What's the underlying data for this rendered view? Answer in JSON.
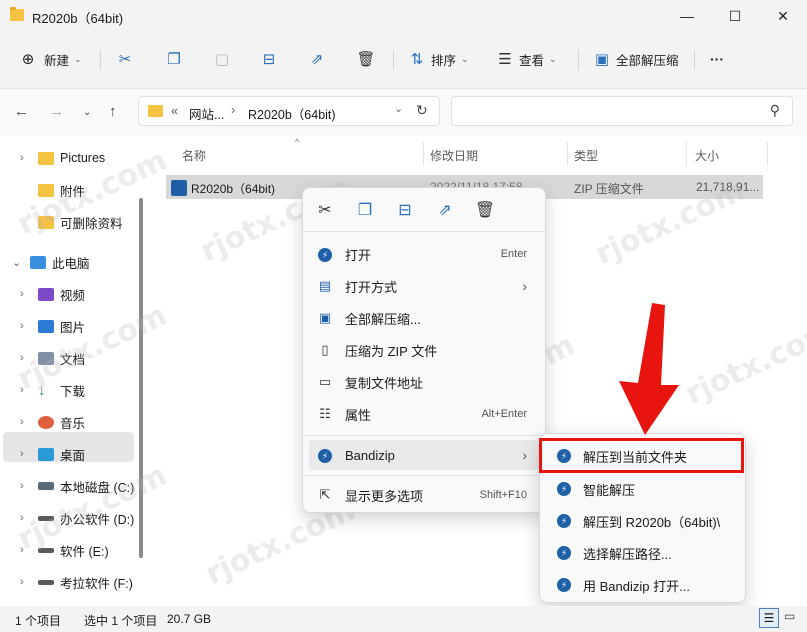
{
  "window": {
    "title": "R2020b（64bit)",
    "minimize": "—",
    "maximize": "☐",
    "close": "✕"
  },
  "toolbar": {
    "new_label": "新建",
    "sort_label": "排序",
    "view_label": "查看",
    "extract_all_label": "全部解压缩",
    "more_label": "···"
  },
  "address": {
    "prefix": "«",
    "crumb1": "网站...",
    "crumb2": "R2020b（64bit)"
  },
  "sidebar": {
    "items": [
      {
        "label": "Pictures",
        "kind": "folder"
      },
      {
        "label": "附件",
        "kind": "folder"
      },
      {
        "label": "可删除资料",
        "kind": "folder"
      },
      {
        "label": "此电脑",
        "kind": "pc"
      },
      {
        "label": "视频",
        "kind": "video"
      },
      {
        "label": "图片",
        "kind": "image"
      },
      {
        "label": "文档",
        "kind": "doc"
      },
      {
        "label": "下载",
        "kind": "download"
      },
      {
        "label": "音乐",
        "kind": "music"
      },
      {
        "label": "桌面",
        "kind": "desktop"
      },
      {
        "label": "本地磁盘 (C:)",
        "kind": "drive"
      },
      {
        "label": "办公软件 (D:)",
        "kind": "drive"
      },
      {
        "label": "软件 (E:)",
        "kind": "drive"
      },
      {
        "label": "考拉软件 (F:)",
        "kind": "drive"
      }
    ]
  },
  "columns": {
    "name": "名称",
    "modified": "修改日期",
    "type": "类型",
    "size": "大小"
  },
  "file": {
    "name": "R2020b（64bit)",
    "modified": "2022/11/18 17:58",
    "type": "ZIP 压缩文件",
    "size": "21,718,91..."
  },
  "context_menu": {
    "items": [
      {
        "label": "打开",
        "shortcut": "Enter"
      },
      {
        "label": "打开方式",
        "shortcut": ""
      },
      {
        "label": "全部解压缩...",
        "shortcut": ""
      },
      {
        "label": "压缩为 ZIP 文件",
        "shortcut": ""
      },
      {
        "label": "复制文件地址",
        "shortcut": ""
      },
      {
        "label": "属性",
        "shortcut": "Alt+Enter"
      },
      {
        "label": "Bandizip",
        "shortcut": ""
      },
      {
        "label": "显示更多选项",
        "shortcut": "Shift+F10"
      }
    ]
  },
  "submenu": {
    "items": [
      {
        "label": "解压到当前文件夹"
      },
      {
        "label": "智能解压"
      },
      {
        "label": "解压到 R2020b（64bit)\\"
      },
      {
        "label": "选择解压路径..."
      },
      {
        "label": "用 Bandizip 打开..."
      }
    ]
  },
  "status": {
    "item_count": "1 个项目",
    "selected": "选中 1 个项目",
    "size": "20.7 GB"
  },
  "watermark": "rjotx.com",
  "colors": {
    "highlight_box": "#e8150f",
    "arrow": "#e8150f",
    "accent": "#1e5fa8"
  }
}
